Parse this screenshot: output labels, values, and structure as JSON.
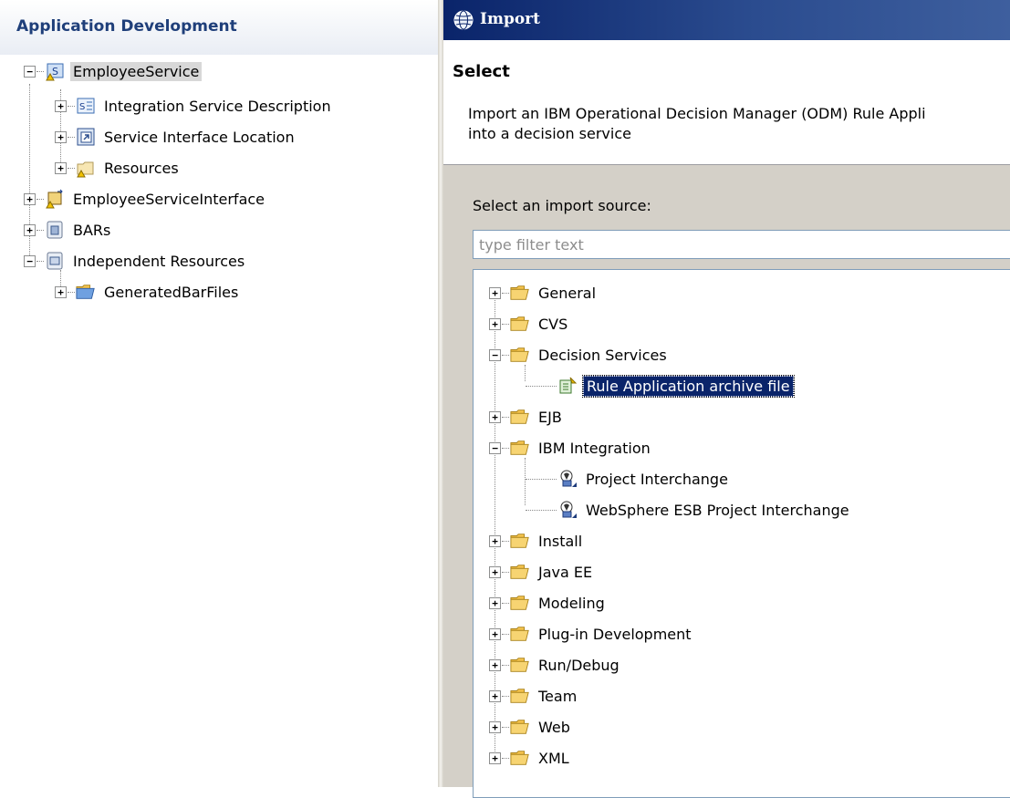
{
  "left_panel": {
    "title": "Application Development",
    "tree": {
      "employee_service": "EmployeeService",
      "integration_service_description": "Integration Service Description",
      "service_interface_location": "Service Interface Location",
      "resources": "Resources",
      "employee_service_interface": "EmployeeServiceInterface",
      "bars": "BARs",
      "independent_resources": "Independent Resources",
      "generated_bar_files": "GeneratedBarFiles"
    }
  },
  "dialog": {
    "title": "Import",
    "banner_title": "Select",
    "banner_description_line1": "Import an IBM Operational Decision Manager (ODM) Rule Appli",
    "banner_description_line2": "into a decision service",
    "source_label": "Select an import source:",
    "filter_placeholder": "type filter text",
    "tree": {
      "general": "General",
      "cvs": "CVS",
      "decision_services": "Decision Services",
      "rule_application_archive_file": "Rule Application archive file",
      "ejb": "EJB",
      "ibm_integration": "IBM Integration",
      "project_interchange": "Project Interchange",
      "websphere_esb_project_interchange": "WebSphere ESB Project Interchange",
      "install": "Install",
      "java_ee": "Java EE",
      "modeling": "Modeling",
      "plugin_development": "Plug-in Development",
      "run_debug": "Run/Debug",
      "team": "Team",
      "web": "Web",
      "xml": "XML"
    }
  },
  "colors": {
    "title_bar": "#0a246a",
    "selection": "#0a246a",
    "folder": "#f4c24c",
    "header_text": "#1f3f7a"
  }
}
